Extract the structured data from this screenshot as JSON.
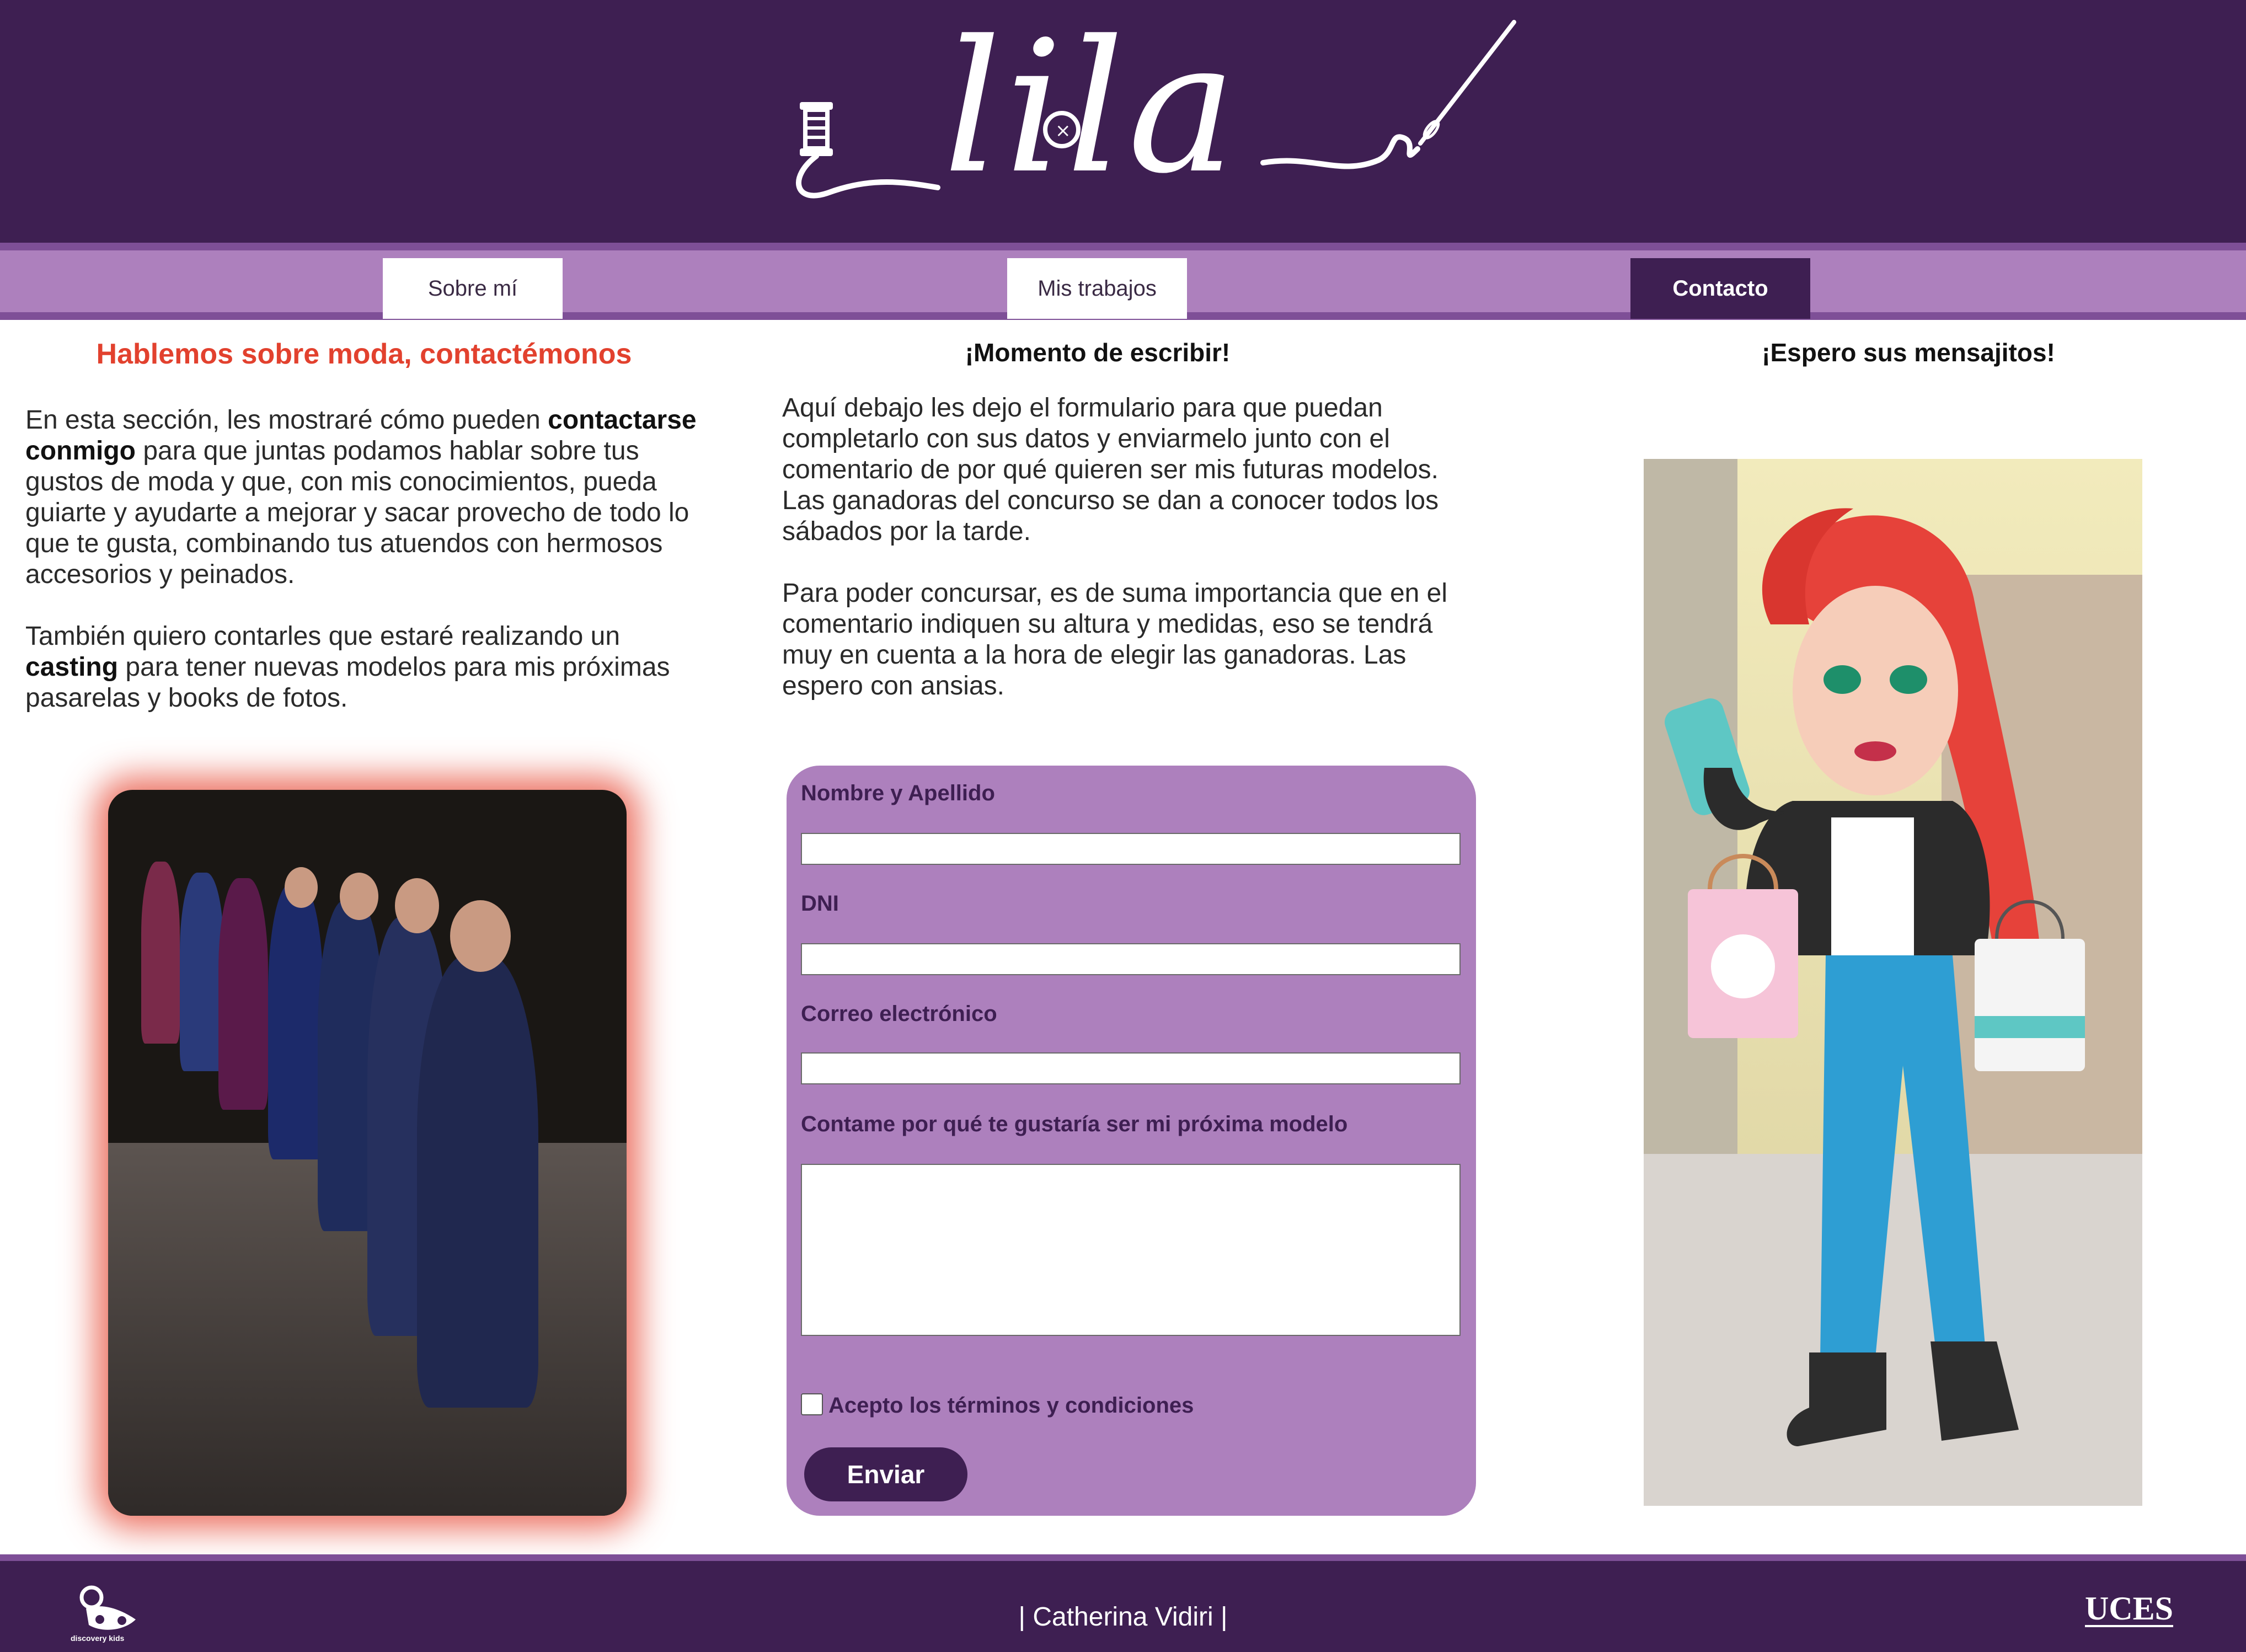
{
  "brand": {
    "logo_text": "lila",
    "colors": {
      "header_bg": "#3e1f52",
      "nav_bg": "#ad80bd",
      "accent_red": "#e2412e",
      "form_bg": "#ad80bd"
    }
  },
  "nav": {
    "items": [
      {
        "label": "Sobre mí",
        "active": false
      },
      {
        "label": "Mis trabajos",
        "active": false
      },
      {
        "label": "Contacto",
        "active": true
      }
    ]
  },
  "left": {
    "title": "Hablemos sobre moda, contactémonos",
    "p1_a": "En esta sección, les mostraré cómo pueden ",
    "p1_b": "contactarse conmigo",
    "p1_c": " para que juntas podamos hablar sobre tus gustos de moda y que, con mis conocimientos, pueda guiarte y ayudarte a mejorar y sacar provecho de todo lo que te gusta, combinando tus atuendos con hermosos accesorios y peinados.",
    "p2_a": "También quiero contarles que estaré realizando un ",
    "p2_b": "casting",
    "p2_c": " para tener nuevas modelos para mis próximas pasarelas y books de fotos."
  },
  "middle": {
    "title": "¡Momento de escribir!",
    "p1": "Aquí debajo les dejo el formulario para que puedan completarlo con sus datos y enviarmelo junto con el comentario de por qué quieren ser mis futuras modelos. Las ganadoras del concurso se dan a conocer todos los sábados por la tarde.",
    "p2": "Para poder concursar, es de suma importancia que en el comentario indiquen su altura y medidas, eso se tendrá muy en cuenta a la hora de elegir las ganadoras. Las espero con ansias."
  },
  "form": {
    "name_label": "Nombre y Apellido",
    "name_value": "",
    "dni_label": "DNI",
    "dni_value": "",
    "email_label": "Correo electrónico",
    "email_value": "",
    "message_label": "Contame por qué te gustaría ser mi próxima modelo",
    "message_value": "",
    "terms_label": "Acepto los términos y condiciones",
    "terms_checked": false,
    "submit_label": "Enviar"
  },
  "right": {
    "title": "¡Espero sus mensajitos!"
  },
  "footer": {
    "author": "| Catherina Vidiri |",
    "left_logo_caption": "discovery kids",
    "right_logo_text": "UCES"
  }
}
